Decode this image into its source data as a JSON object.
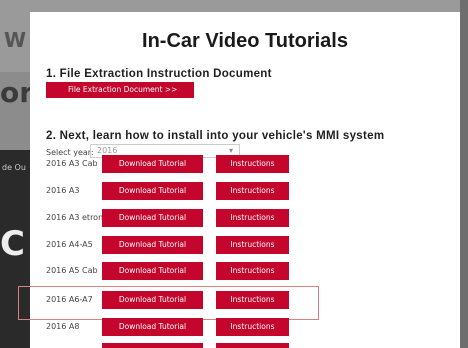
{
  "background": {
    "fragment_top": "W",
    "fragment_mid": "or",
    "fragment_small": "de Ou",
    "fragment_bottom": "C"
  },
  "modal": {
    "title": "In-Car Video Tutorials",
    "step1_label": "1. File Extraction Instruction Document",
    "file_button_label": "File Extraction Document    >>",
    "step2_label": "2. Next, learn how to install into your vehicle's MMI system",
    "select_label": "Select year:",
    "select_value": "2016",
    "rows": [
      {
        "model": "2016 A3 Cab",
        "download": "Download Tutorial",
        "instructions": "Instructions"
      },
      {
        "model": "2016 A3",
        "download": "Download Tutorial",
        "instructions": "Instructions"
      },
      {
        "model": "2016 A3 etron",
        "download": "Download Tutorial",
        "instructions": "Instructions"
      },
      {
        "model": "2016 A4-A5",
        "download": "Download Tutorial",
        "instructions": "Instructions"
      },
      {
        "model": "2016 A5 Cab",
        "download": "Download Tutorial",
        "instructions": "Instructions"
      },
      {
        "model": "2016 A6-A7",
        "download": "Download Tutorial",
        "instructions": "Instructions"
      },
      {
        "model": "2016 A8",
        "download": "Download Tutorial",
        "instructions": "Instructions"
      }
    ]
  },
  "colors": {
    "accent": "#c4062d",
    "highlight": "#d98080"
  }
}
